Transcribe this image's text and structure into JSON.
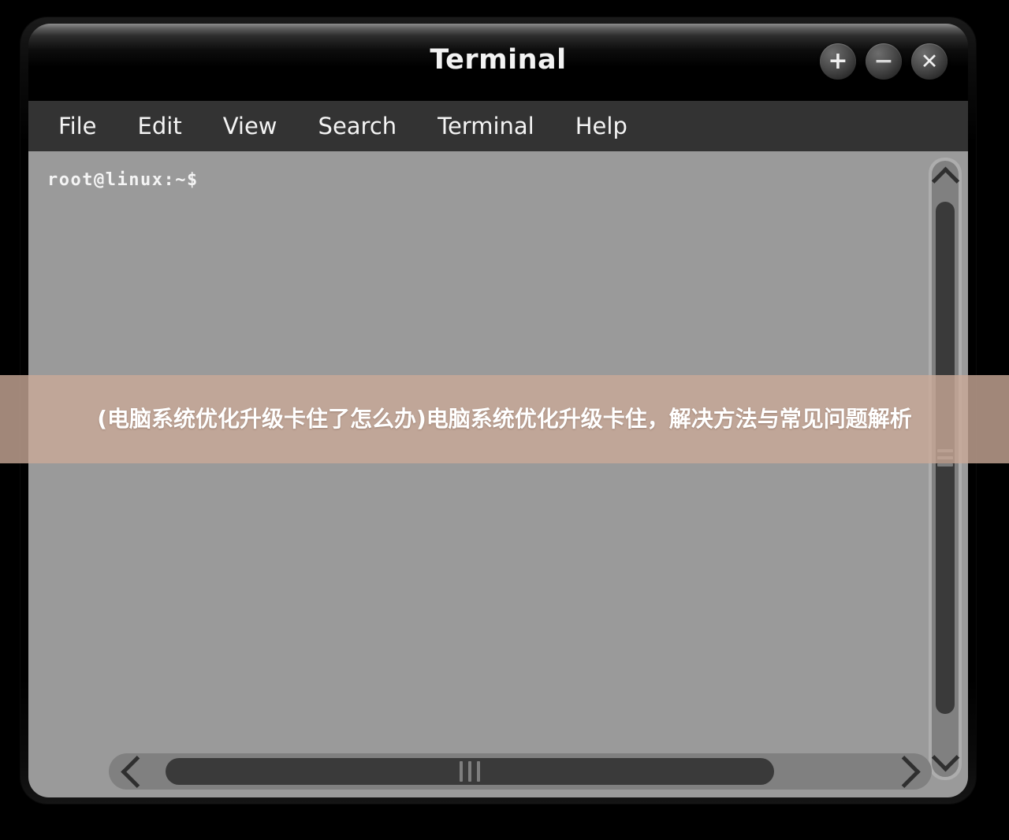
{
  "window": {
    "title": "Terminal",
    "controls": [
      {
        "name": "maximize-button",
        "glyph": "+",
        "label": "Maximize"
      },
      {
        "name": "minimize-button",
        "glyph": "−",
        "label": "Minimize"
      },
      {
        "name": "close-button",
        "glyph": "✕",
        "label": "Close"
      }
    ]
  },
  "menu": {
    "items": [
      {
        "label": "File"
      },
      {
        "label": "Edit"
      },
      {
        "label": "View"
      },
      {
        "label": "Search"
      },
      {
        "label": "Terminal"
      },
      {
        "label": "Help"
      }
    ]
  },
  "terminal": {
    "prompt": "root@linux:~$",
    "background_color": "#9a9a9a",
    "text_color": "#f4f4f4"
  },
  "scrollbars": {
    "vertical": {
      "up_arrow_icon": "chevron-up-icon",
      "down_arrow_icon": "chevron-down-icon",
      "thumb_color": "#3a3a3a",
      "track_color": "#808080"
    },
    "horizontal": {
      "left_arrow_icon": "chevron-left-icon",
      "right_arrow_icon": "chevron-right-icon",
      "thumb_color": "#3a3a3a",
      "track_color": "#808080"
    }
  },
  "overlay": {
    "banner_text": "(电脑系统优化升级卡住了怎么办)电脑系统优化升级卡住，解决方法与常见问题解析",
    "banner_color": "#c9a997",
    "text_color": "#ffffff"
  }
}
